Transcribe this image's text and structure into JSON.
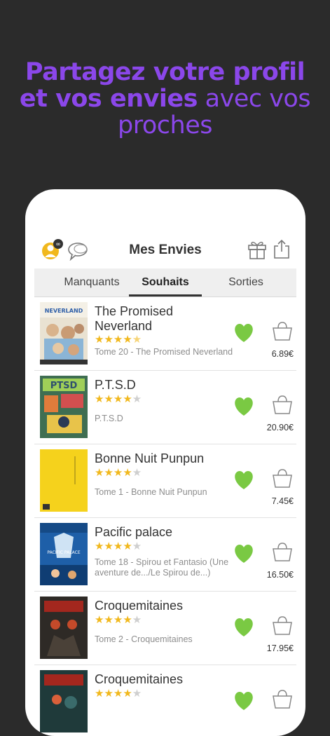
{
  "headline": {
    "line1": "Partagez votre profil",
    "line2_bold": "et vos envies",
    "line2_light": " avec vos",
    "line3": "proches"
  },
  "header": {
    "title": "Mes Envies"
  },
  "tabs": [
    {
      "label": "Manquants",
      "active": false
    },
    {
      "label": "Souhaits",
      "active": true
    },
    {
      "label": "Sorties",
      "active": false
    }
  ],
  "items": [
    {
      "title": "The Promised Neverland",
      "rating": 4.5,
      "subtitle": "Tome 20 - The Promised Neverland",
      "price": "6.89€"
    },
    {
      "title": "P.T.S.D",
      "rating": 4,
      "subtitle": "P.T.S.D",
      "price": "20.90€"
    },
    {
      "title": "Bonne Nuit Punpun",
      "rating": 4,
      "subtitle": "Tome 1 - Bonne Nuit Punpun",
      "price": "7.45€"
    },
    {
      "title": "Pacific palace",
      "rating": 4,
      "subtitle": "Tome 18 - Spirou et Fantasio (Une aventure de.../Le Spirou de...)",
      "price": "16.50€"
    },
    {
      "title": "Croquemitaines",
      "rating": 4,
      "subtitle": "Tome 2 - Croquemitaines",
      "price": "17.95€"
    },
    {
      "title": "Croquemitaines",
      "rating": 4,
      "subtitle": "",
      "price": ""
    }
  ],
  "colors": {
    "accent": "#8b47ea",
    "heart": "#7ac943",
    "star": "#f1b81d",
    "background": "#2b2b2b"
  },
  "cover_text": {
    "neverland": "NEVERLAND",
    "ptsd": "PTSD",
    "pacific": "PACIFIC PALACE"
  }
}
